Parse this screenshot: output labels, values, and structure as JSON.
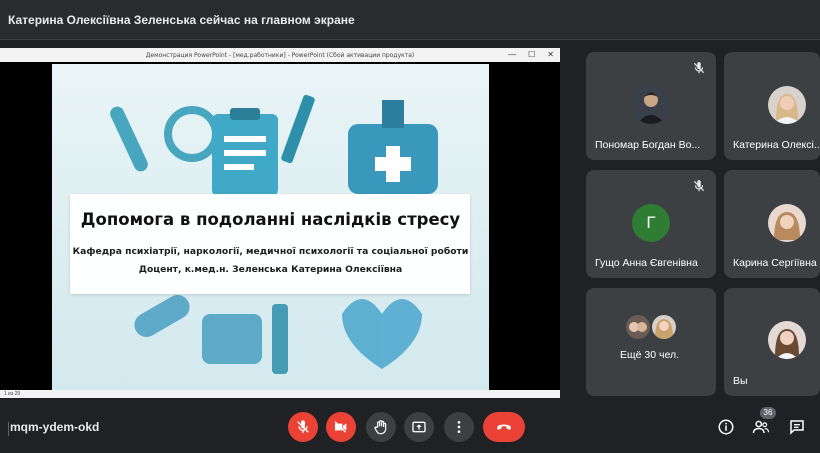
{
  "banner": {
    "text": "Катерина Олексіївна Зеленська сейчас на главном экране"
  },
  "presentation": {
    "window_title": "Демонстрация PowerPoint - [мед.работники] - PowerPoint (Сбой активации продукта)",
    "window_controls": [
      "—",
      "☐",
      "✕"
    ],
    "status_text": "1 из 29",
    "slide": {
      "title": "Допомога в подоланні наслідків стресу",
      "line1": "Кафедра психіатрії, наркології, медичної психології та соціальної роботи",
      "line2": "Доцент, к.мед.н. Зеленська Катерина Олексіївна"
    }
  },
  "participants": [
    {
      "name": "Пономар Богдан Во...",
      "muted": true,
      "avatar": "photo-man"
    },
    {
      "name": "Катерина Олексі...",
      "muted": false,
      "avatar": "photo-woman"
    },
    {
      "name": "Гущо Анна Євгенівна",
      "muted": true,
      "avatar_letter": "Г",
      "avatar_color": "#2e7d32"
    },
    {
      "name": "Карина Сергіївна",
      "muted": false,
      "avatar": "photo-woman"
    },
    {
      "name": "Ещё 30 чел.",
      "muted": false,
      "avatar": "group"
    },
    {
      "name": "Вы",
      "muted": false,
      "avatar": "photo-woman"
    }
  ],
  "bottombar": {
    "meeting_code": "mqm-ydem-okd",
    "participant_count": "36",
    "icons": [
      "mic-off-icon",
      "camera-off-icon",
      "hand-icon",
      "present-icon",
      "more-icon",
      "end-call-icon",
      "info-icon",
      "people-icon",
      "chat-icon"
    ]
  },
  "colors": {
    "background": "#202124",
    "tile": "#3c4043",
    "danger": "#ea4335",
    "accent_green": "#2e7d32"
  }
}
